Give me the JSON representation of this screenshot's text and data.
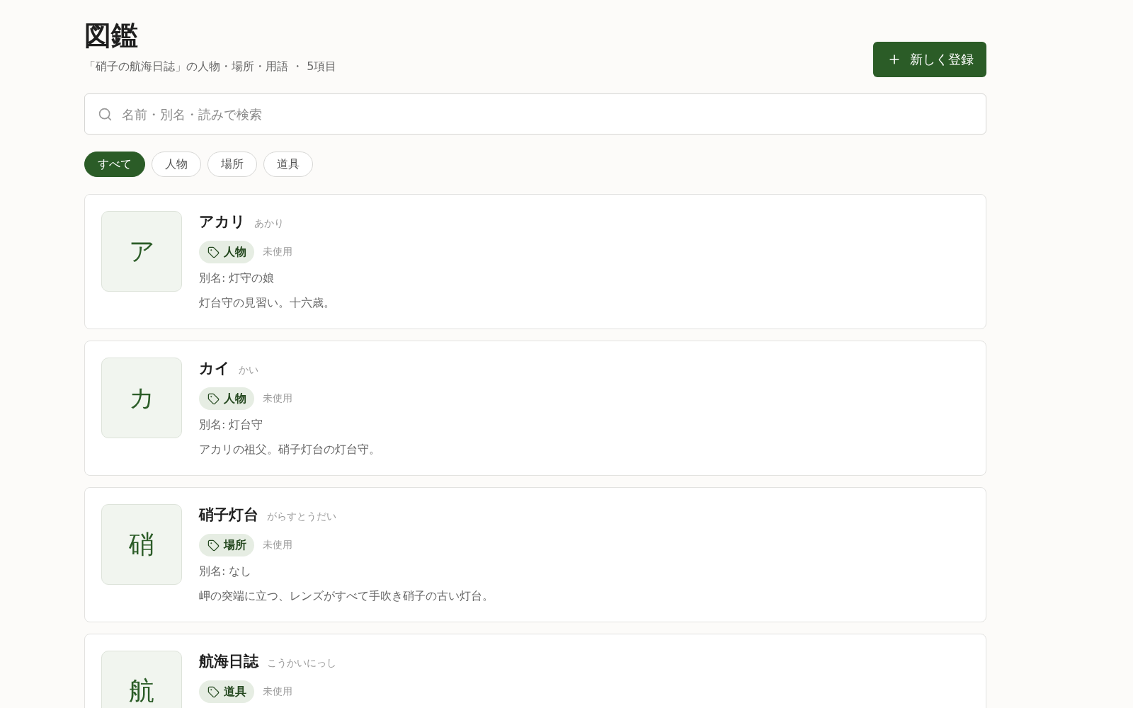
{
  "page": {
    "title": "図鑑",
    "subtitle": "「硝子の航海日誌」の人物・場所・用語 ・ 5項目"
  },
  "new_button": {
    "label": "新しく登録"
  },
  "search": {
    "placeholder": "名前・別名・読みで検索"
  },
  "filters": [
    {
      "label": "すべて",
      "selected": true
    },
    {
      "label": "人物",
      "selected": false
    },
    {
      "label": "場所",
      "selected": false
    },
    {
      "label": "道具",
      "selected": false
    }
  ],
  "entries": [
    {
      "initial": "ア",
      "name": "アカリ",
      "reading": "あかり",
      "category": "人物",
      "usage": "未使用",
      "alias": "別名: 灯守の娘",
      "description": "灯台守の見習い。十六歳。"
    },
    {
      "initial": "カ",
      "name": "カイ",
      "reading": "かい",
      "category": "人物",
      "usage": "未使用",
      "alias": "別名: 灯台守",
      "description": "アカリの祖父。硝子灯台の灯台守。"
    },
    {
      "initial": "硝",
      "name": "硝子灯台",
      "reading": "がらすとうだい",
      "category": "場所",
      "usage": "未使用",
      "alias": "別名: なし",
      "description": "岬の突端に立つ、レンズがすべて手吹き硝子の古い灯台。"
    },
    {
      "initial": "航",
      "name": "航海日誌",
      "reading": "こうかいにっし",
      "category": "道具",
      "usage": "未使用"
    }
  ]
}
